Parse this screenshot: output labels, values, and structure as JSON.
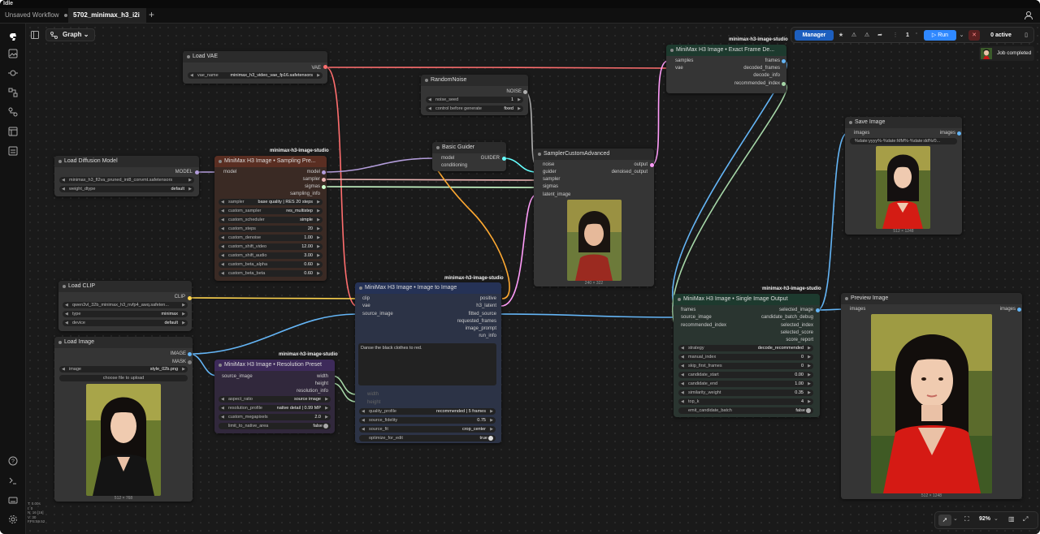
{
  "app": {
    "title": "Idle"
  },
  "tabs": [
    {
      "label": "Unsaved Workflow"
    },
    {
      "label": "5702_minimax_h3_i2i"
    }
  ],
  "graph_menu": "Graph",
  "toolbar": {
    "manager": "Manager",
    "queue_count": "1",
    "run": "Run",
    "active": "0 active"
  },
  "job": {
    "label": "Job completed"
  },
  "zoom": "92%",
  "stats": [
    "T: 0.00s",
    "I: 0",
    "N: 16 [16]",
    "V: 30",
    "FPS:59.52"
  ],
  "nodes": {
    "load_vae": {
      "title": "Load VAE",
      "out": "VAE",
      "w_name": "vae_name",
      "w_val": "minimax_h3_video_vae_fp16.safetensors"
    },
    "random_noise": {
      "title": "RandomNoise",
      "out": "NOISE",
      "w1": "noise_seed",
      "w1v": "1",
      "w2": "control before generate",
      "w2v": "fixed"
    },
    "exact_frame": {
      "tag": "minimax-h3-image-studio",
      "title": "MiniMax H3 Image • Exact Frame De...",
      "in": [
        "samples",
        "vae"
      ],
      "out": [
        "frames",
        "decoded_frames",
        "decode_info",
        "recommended_index"
      ]
    },
    "load_diffusion": {
      "title": "Load Diffusion Model",
      "out": "MODEL",
      "w1": "minimax_h3_fl2va_pruned_int8_convmt.safetensors",
      "w2": "weight_dtype",
      "w2v": "default"
    },
    "sampling_preset": {
      "tag": "minimax-h3-image-studio",
      "title": "MiniMax H3 Image • Sampling Pre...",
      "in": "model",
      "out": [
        "model",
        "sampler",
        "sigmas",
        "sampling_info"
      ],
      "widgets": [
        [
          "sampler",
          "base quality | RES 20 steps"
        ],
        [
          "custom_sampler",
          "res_multistep"
        ],
        [
          "custom_scheduler",
          "simple"
        ],
        [
          "custom_steps",
          "20"
        ],
        [
          "custom_denoise",
          "1.00"
        ],
        [
          "custom_shift_video",
          "12.00"
        ],
        [
          "custom_shift_audio",
          "3.00"
        ],
        [
          "custom_beta_alpha",
          "0.60"
        ],
        [
          "custom_beta_beta",
          "0.60"
        ]
      ]
    },
    "basic_guider": {
      "title": "Basic Guider",
      "in": [
        "model",
        "conditioning"
      ],
      "out": "GUIDER"
    },
    "sampler_custom": {
      "title": "SamplerCustomAdvanced",
      "in": [
        "noise",
        "guider",
        "sampler",
        "sigmas",
        "latent_image"
      ],
      "out": [
        "output",
        "denoised_output"
      ],
      "cap": "240 × 322"
    },
    "save_image": {
      "title": "Save Image",
      "in": "images",
      "out": "images",
      "prefix": "%date:yyyy%-%date:MM%-%date:dd%/0...",
      "cap": "512 × 1248"
    },
    "load_clip": {
      "title": "Load CLIP",
      "out": "CLIP",
      "w1": "qwen3vl_32b_minimax_h3_nvfp4_awq.safeten...",
      "w2": "type",
      "w2v": "minimax",
      "w3": "device",
      "w3v": "default"
    },
    "image_to_image": {
      "tag": "minimax-h3-image-studio",
      "title": "MiniMax H3 Image • Image to Image",
      "in": [
        "clip",
        "vae",
        "source_image"
      ],
      "out": [
        "positive",
        "h3_latent",
        "fitted_source",
        "requested_frames",
        "image_prompt",
        "run_info"
      ],
      "prompt": "Danse the black clothes to red.",
      "dim": [
        "width",
        "height"
      ],
      "widgets": [
        [
          "quality_profile",
          "recommended | 5 frames"
        ],
        [
          "source_fidelity",
          "0.75"
        ],
        [
          "source_fit",
          "crop_center"
        ],
        [
          "optimize_for_edit",
          "true"
        ]
      ]
    },
    "single_output": {
      "tag": "minimax-h3-image-studio",
      "title": "MiniMax H3 Image • Single Image Output",
      "in": [
        "frames",
        "source_image",
        "recommended_index"
      ],
      "out": [
        "selected_image",
        "candidate_batch_debug",
        "selected_index",
        "selected_score",
        "score_report"
      ],
      "widgets": [
        [
          "strategy",
          "decode_recommended"
        ],
        [
          "manual_index",
          "0"
        ],
        [
          "skip_first_frames",
          "0"
        ],
        [
          "candidate_start",
          "0.00"
        ],
        [
          "candidate_end",
          "1.00"
        ],
        [
          "similarity_weight",
          "0.35"
        ],
        [
          "top_k",
          "4"
        ],
        [
          "emit_candidate_batch",
          "false"
        ]
      ]
    },
    "preview_image": {
      "title": "Preview Image",
      "in": "images",
      "out": "images",
      "cap": "512 × 1248"
    },
    "load_image": {
      "title": "Load Image",
      "out": [
        "IMAGE",
        "MASK"
      ],
      "w1": "image",
      "w1v": "style_02b.png",
      "upload": "choose file to upload",
      "cap": "512 × 768"
    },
    "resolution_preset": {
      "tag": "minimax-h3-image-studio",
      "title": "MiniMax H3 Image • Resolution Preset",
      "in": "source_image",
      "out": [
        "width",
        "height",
        "resolution_info"
      ],
      "widgets": [
        [
          "aspect_ratio",
          "source image"
        ],
        [
          "resolution_profile",
          "native detail | 0.99 MP"
        ],
        [
          "custom_megapixels",
          "2.0"
        ],
        [
          "limit_to_native_area",
          "false"
        ]
      ]
    }
  },
  "colors": {
    "vae": "#ff6e6e",
    "model": "#b39ddb",
    "clip": "#ffd54f",
    "image": "#64b5f6",
    "latent": "#ff9cf9",
    "int": "#a5d6a7",
    "sampler": "#ecb4b4",
    "sigmas": "#cdffcd",
    "noise": "#b0b0b0",
    "guider": "#66ffff",
    "conditioning": "#ffa931"
  }
}
